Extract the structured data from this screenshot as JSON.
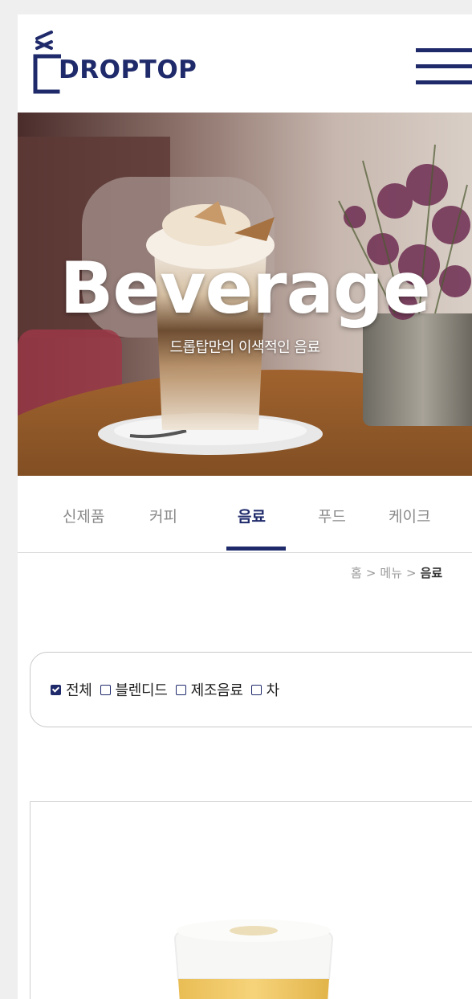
{
  "brand": {
    "logo_text": "DROPTOP",
    "primary_color": "#1f2a6b"
  },
  "header": {
    "menu_icon": "hamburger-menu-icon"
  },
  "hero": {
    "title": "Beverage",
    "subtitle": "드롭탑만의 이색적인 음료"
  },
  "tabs": [
    {
      "label": "신제품",
      "active": false
    },
    {
      "label": "커피",
      "active": false
    },
    {
      "label": "음료",
      "active": true
    },
    {
      "label": "푸드",
      "active": false
    },
    {
      "label": "케이크",
      "active": false
    }
  ],
  "breadcrumb": {
    "home": "홈",
    "separator": ">",
    "menu": "메뉴",
    "current": "음료"
  },
  "filter": {
    "options": [
      {
        "label": "전체",
        "checked": true
      },
      {
        "label": "블렌디드",
        "checked": false
      },
      {
        "label": "제조음료",
        "checked": false
      },
      {
        "label": "차",
        "checked": false
      }
    ]
  }
}
